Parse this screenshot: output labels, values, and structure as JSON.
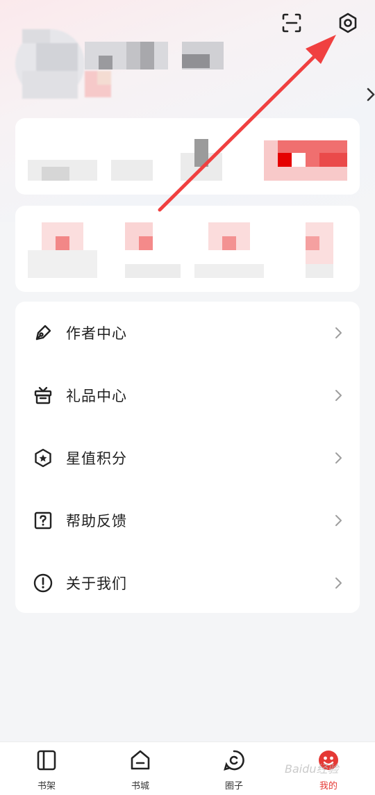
{
  "colors": {
    "accent": "#e53935",
    "arrow": "#f04040",
    "background": "#f4f5f7",
    "card": "#ffffff"
  },
  "header": {
    "scan_icon": "scan-icon",
    "settings_icon": "gear-icon"
  },
  "menu": {
    "items": [
      {
        "label": "作者中心",
        "icon": "pen-icon"
      },
      {
        "label": "礼品中心",
        "icon": "gift-icon"
      },
      {
        "label": "星值积分",
        "icon": "star-hexagon-icon"
      },
      {
        "label": "帮助反馈",
        "icon": "question-icon"
      },
      {
        "label": "关于我们",
        "icon": "info-icon"
      }
    ]
  },
  "tabbar": {
    "tabs": [
      {
        "label": "书架",
        "icon": "bookshelf-icon"
      },
      {
        "label": "书城",
        "icon": "bookstore-icon"
      },
      {
        "label": "圈子",
        "icon": "circle-chat-icon"
      },
      {
        "label": "我的",
        "icon": "profile-face-icon",
        "active": true
      }
    ]
  },
  "watermark": "Baidu经验"
}
